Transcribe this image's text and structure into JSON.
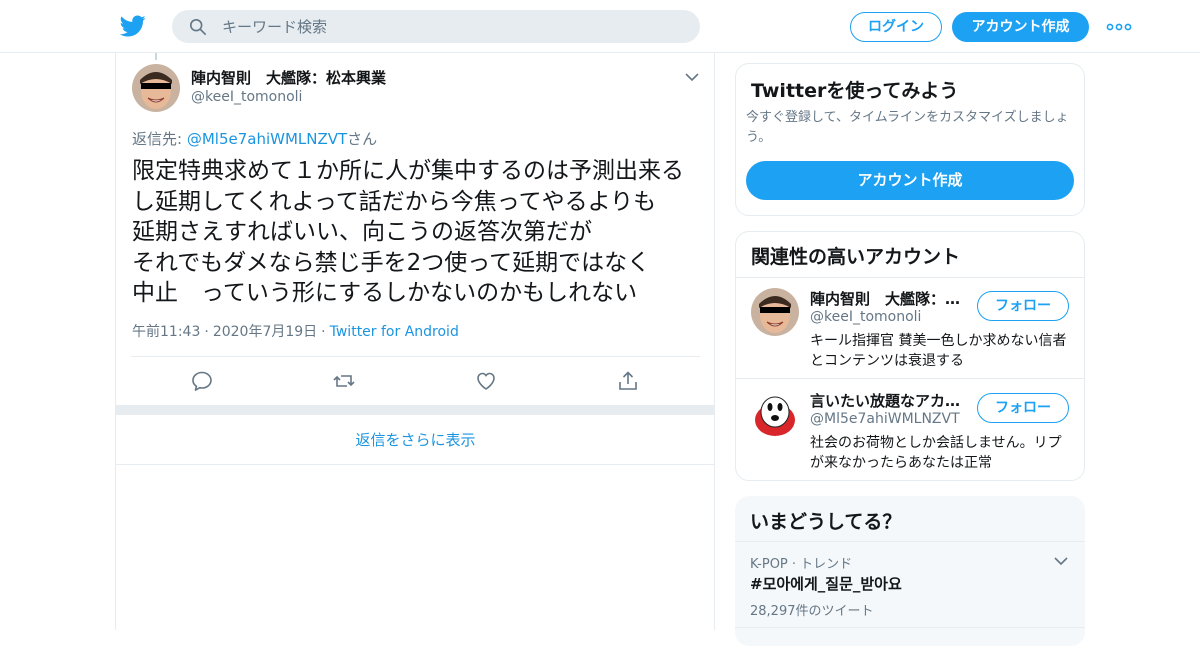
{
  "header": {
    "search_placeholder": "キーワード検索",
    "login_label": "ログイン",
    "signup_label": "アカウント作成",
    "brand_color": "#1da1f2"
  },
  "tweet": {
    "display_name": "陣内智則　大艦隊：松本興業",
    "handle": "@keeI_tomonoli",
    "reply_prefix": "返信先: ",
    "reply_mention": "@Ml5e7ahiWMLNZVT",
    "reply_suffix": "さん",
    "text": "限定特典求めて１か所に人が集中するのは予測出来る\nし延期してくれよって話だから今焦ってやるよりも\n延期さえすればいい、向こうの返答次第だが\nそれでもダメなら禁じ手を2つ使って延期ではなく\n中止　っていう形にするしかないのかもしれない",
    "time": "午前11:43",
    "date": "2020年7月19日",
    "source": "Twitter for Android",
    "actions": [
      "reply-icon",
      "retweet-icon",
      "like-icon",
      "share-icon"
    ]
  },
  "show_more_label": "返信をさらに表示",
  "sidebar": {
    "signup_card": {
      "title": "Twitterを使ってみよう",
      "subtitle": "今すぐ登録して、タイムラインをカスタマイズしましょう。",
      "button": "アカウント作成"
    },
    "related": {
      "title": "関連性の高いアカウント",
      "accounts": [
        {
          "name": "陣内智則　大艦隊：…",
          "handle": "@keeI_tomonoli",
          "bio": "キール指揮官 賛美一色しか求めない信者とコンテンツは衰退する",
          "follow": "フォロー"
        },
        {
          "name": "言いたい放題なアカ…",
          "handle": "@Ml5e7ahiWMLNZVT",
          "bio": "社会のお荷物としか会話しません。リプが来なかったらあなたは正常",
          "follow": "フォロー"
        }
      ]
    },
    "trends": {
      "title": "いまどうしてる？",
      "items": [
        {
          "context": "K-POP · トレンド",
          "name": "#모아에게_질문_받아요",
          "count": "28,297件のツイート"
        }
      ]
    }
  }
}
